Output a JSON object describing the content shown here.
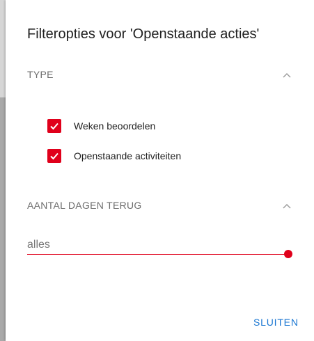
{
  "dialog": {
    "title": "Filteropties voor 'Openstaande acties'"
  },
  "sections": {
    "type": {
      "label": "TYPE",
      "expanded": true,
      "options": [
        {
          "label": "Weken beoordelen",
          "checked": true
        },
        {
          "label": "Openstaande activiteiten",
          "checked": true
        }
      ]
    },
    "days_back": {
      "label": "AANTAL DAGEN TERUG",
      "expanded": true,
      "slider_value": "alles",
      "slider_level": 1.0
    }
  },
  "actions": {
    "close_label": "SLUITEN"
  },
  "colors": {
    "accent": "#e0001b",
    "button": "#1976d2"
  },
  "icons": {
    "collapse": "chevron-up-icon",
    "check": "checkmark-icon"
  }
}
